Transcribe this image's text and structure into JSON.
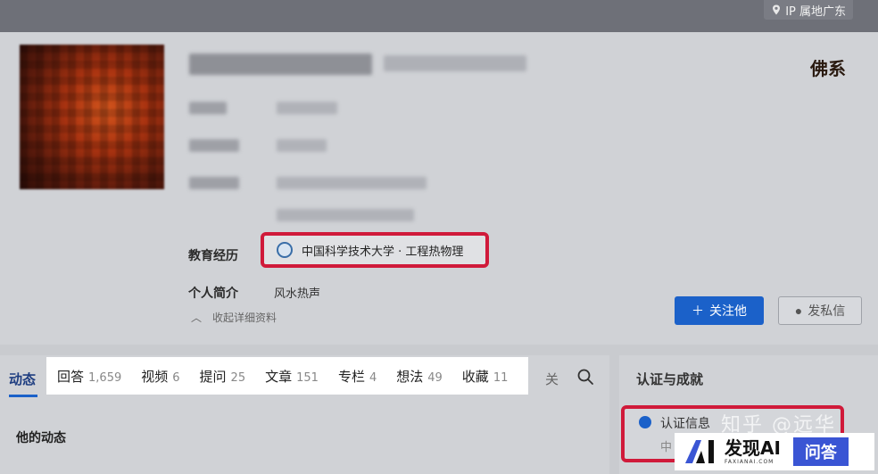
{
  "topbar": {
    "ip_label": "IP 属地广东"
  },
  "profile": {
    "badge_text": "佛系",
    "education_label": "教育经历",
    "education_value": "中国科学技术大学 · 工程热物理",
    "bio_label": "个人简介",
    "bio_value": "风水热声",
    "collapse_label": "收起详细资料",
    "follow_button": "关注他",
    "message_button": "发私信"
  },
  "tabs": {
    "active": "动态",
    "items": [
      {
        "label": "回答",
        "count": "1,659"
      },
      {
        "label": "视频",
        "count": "6"
      },
      {
        "label": "提问",
        "count": "25"
      },
      {
        "label": "文章",
        "count": "151"
      },
      {
        "label": "专栏",
        "count": "4"
      },
      {
        "label": "想法",
        "count": "49"
      },
      {
        "label": "收藏",
        "count": "11"
      }
    ],
    "more": "关",
    "section_title": "他的动态"
  },
  "sidebar": {
    "title": "认证与成就",
    "cert_label": "认证信息",
    "cert_sub": "中",
    "watermark": "知乎 @远华"
  },
  "brand": {
    "name": "发现AI",
    "url": "FAXIANAI.COM",
    "qa": "问答"
  },
  "colors": {
    "accent": "#1b61c9",
    "highlight": "#d01a3a",
    "brand_qa": "#3a55d4"
  }
}
